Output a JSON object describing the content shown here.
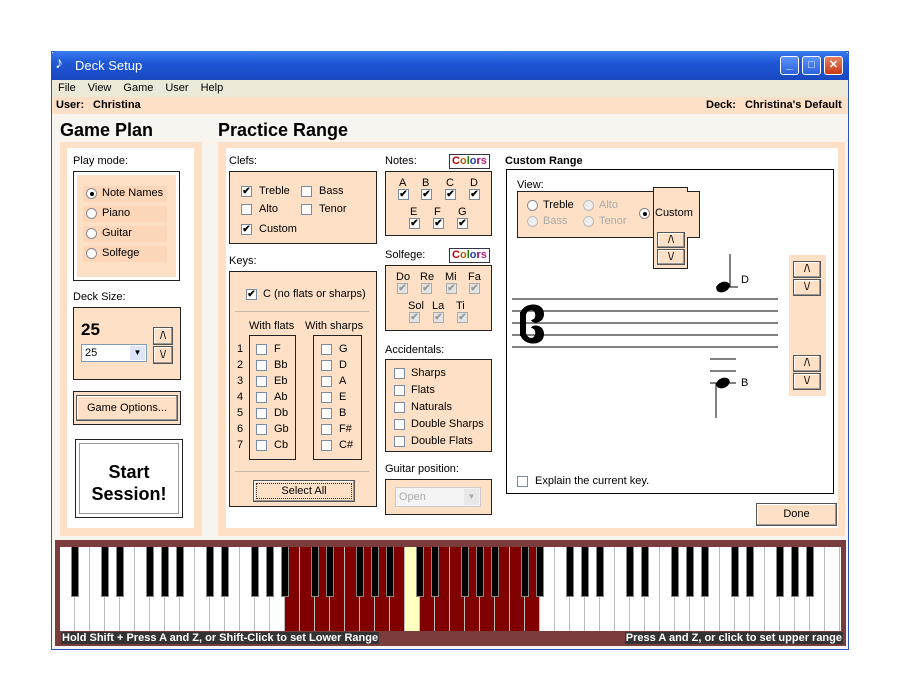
{
  "window": {
    "title": "Deck Setup",
    "icon": "music-note-icon",
    "buttons": [
      "minimize",
      "maximize",
      "close"
    ]
  },
  "menu": [
    "File",
    "View",
    "Game",
    "User",
    "Help"
  ],
  "userbar": {
    "user_label": "User:",
    "user": "Christina",
    "deck_label": "Deck:",
    "deck": "Christina's Default"
  },
  "game_plan": {
    "title": "Game Plan",
    "play_mode_label": "Play mode:",
    "play_modes": [
      {
        "label": "Note Names",
        "selected": true
      },
      {
        "label": "Piano",
        "selected": false
      },
      {
        "label": "Guitar",
        "selected": false
      },
      {
        "label": "Solfege",
        "selected": false
      }
    ],
    "deck_size_label": "Deck Size:",
    "deck_size": "25",
    "deck_size_select": "25",
    "up": "/\\",
    "down": "\\/",
    "game_options": "Game Options...",
    "start_line1": "Start",
    "start_line2": "Session!"
  },
  "practice": {
    "title": "Practice Range",
    "clefs_label": "Clefs:",
    "clefs": [
      {
        "label": "Treble",
        "checked": true
      },
      {
        "label": "Bass",
        "checked": false
      },
      {
        "label": "Alto",
        "checked": false
      },
      {
        "label": "Tenor",
        "checked": false
      },
      {
        "label": "Custom",
        "checked": true
      }
    ],
    "keys_label": "Keys:",
    "c_key": "C (no flats or sharps)",
    "c_checked": true,
    "flats_label": "With flats",
    "sharps_label": "With sharps",
    "numbers": [
      "1",
      "2",
      "3",
      "4",
      "5",
      "6",
      "7"
    ],
    "flats": [
      "F",
      "Bb",
      "Eb",
      "Ab",
      "Db",
      "Gb",
      "Cb"
    ],
    "sharps": [
      "G",
      "D",
      "A",
      "E",
      "B",
      "F#",
      "C#"
    ],
    "select_all": "Select All",
    "notes_label": "Notes:",
    "colors_label": "Colors",
    "notes": [
      "A",
      "B",
      "C",
      "D",
      "E",
      "F",
      "G"
    ],
    "solfege_label": "Solfege:",
    "solfege": [
      "Do",
      "Re",
      "Mi",
      "Fa",
      "Sol",
      "La",
      "Ti"
    ],
    "accidentals_label": "Accidentals:",
    "accidentals": [
      "Sharps",
      "Flats",
      "Naturals",
      "Double Sharps",
      "Double Flats"
    ],
    "guitar_label": "Guitar position:",
    "guitar_value": "Open"
  },
  "custom_range": {
    "title": "Custom Range",
    "view_label": "View:",
    "views": [
      {
        "label": "Treble",
        "enabled": true
      },
      {
        "label": "Alto",
        "enabled": false
      },
      {
        "label": "Bass",
        "enabled": false
      },
      {
        "label": "Tenor",
        "enabled": false
      },
      {
        "label": "Custom",
        "enabled": true,
        "selected": true
      }
    ],
    "upper_note": "D",
    "lower_note": "B",
    "explain": "Explain the current key.",
    "done": "Done"
  },
  "piano": {
    "white_keys": 52,
    "lowest": "A0",
    "range_low": "B2",
    "range_high": "D5",
    "highlight": "C4",
    "range_color": "#800000",
    "highlight_color": "#ffffc0",
    "left_hint": "Hold Shift + Press A and Z, or Shift-Click to set Lower Range",
    "right_hint": "Press A and Z, or click to set upper range"
  }
}
